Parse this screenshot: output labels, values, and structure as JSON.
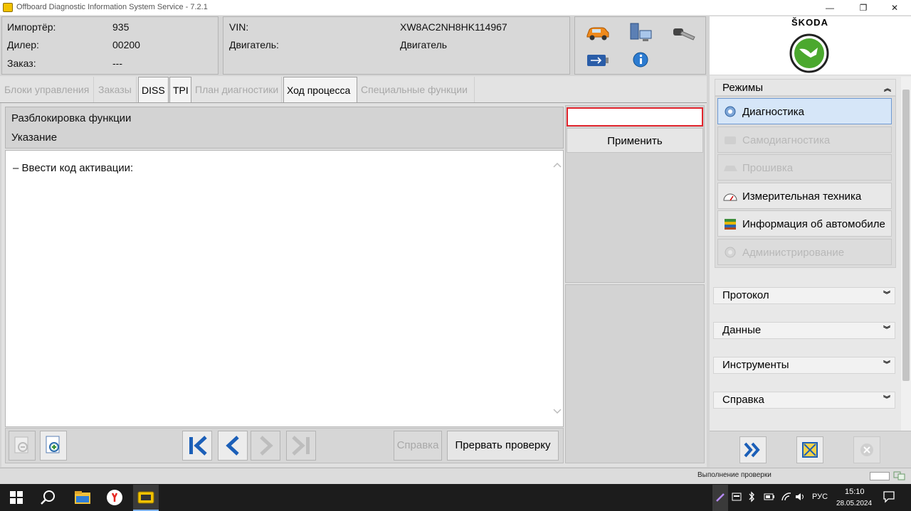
{
  "window": {
    "title": "Offboard Diagnostic Information System Service - 7.2.1",
    "minimize": "—",
    "restore": "❐",
    "close": "✕"
  },
  "vehicle": {
    "importer_label": "Импортёр:",
    "importer_value": "935",
    "dealer_label": "Дилер:",
    "dealer_value": "00200",
    "order_label": "Заказ:",
    "order_value": "---",
    "vin_label": "VIN:",
    "vin_value": "XW8AC2NH8HK114967",
    "engine_label": "Двигатель:",
    "engine_value": "Двигатель"
  },
  "brand": {
    "name": "ŠKODA",
    "color": "#4ba82e"
  },
  "tabs": [
    {
      "label": "Блоки управления",
      "active": false
    },
    {
      "label": "Заказы",
      "active": false
    },
    {
      "label": "DISS",
      "active": true
    },
    {
      "label": "TPI",
      "active": true
    },
    {
      "label": "План диагностики",
      "active": false
    },
    {
      "label": "Ход процесса",
      "active": true
    },
    {
      "label": "Специальные функции",
      "active": false
    }
  ],
  "procedure": {
    "title": "Разблокировка функции",
    "subtitle": "Указание",
    "instruction": "– Ввести код активации:",
    "input_value": "",
    "apply_label": "Применить"
  },
  "bottom": {
    "help_label": "Справка",
    "abort_label": "Прервать проверку"
  },
  "modes": {
    "header": "Режимы",
    "items": [
      {
        "label": "Диагностика",
        "state": "selected",
        "icon": "stethoscope-icon"
      },
      {
        "label": "Самодиагностика",
        "state": "disabled",
        "icon": "car-icon"
      },
      {
        "label": "Прошивка",
        "state": "disabled",
        "icon": "car-flash-icon"
      },
      {
        "label": "Измерительная техника",
        "state": "enabled",
        "icon": "gauge-icon"
      },
      {
        "label": "Информация об автомобиле",
        "state": "enabled",
        "icon": "books-icon"
      },
      {
        "label": "Администрирование",
        "state": "disabled",
        "icon": "gear-icon"
      }
    ]
  },
  "sections": [
    {
      "label": "Протокол"
    },
    {
      "label": "Данные"
    },
    {
      "label": "Инструменты"
    },
    {
      "label": "Справка"
    }
  ],
  "status": {
    "text": "Выполнение проверки"
  },
  "taskbar": {
    "lang": "РУС",
    "time": "15:10",
    "date": "28.05.2024"
  },
  "colors": {
    "accent_blue": "#1b5fb8",
    "input_border": "#e0242c"
  }
}
